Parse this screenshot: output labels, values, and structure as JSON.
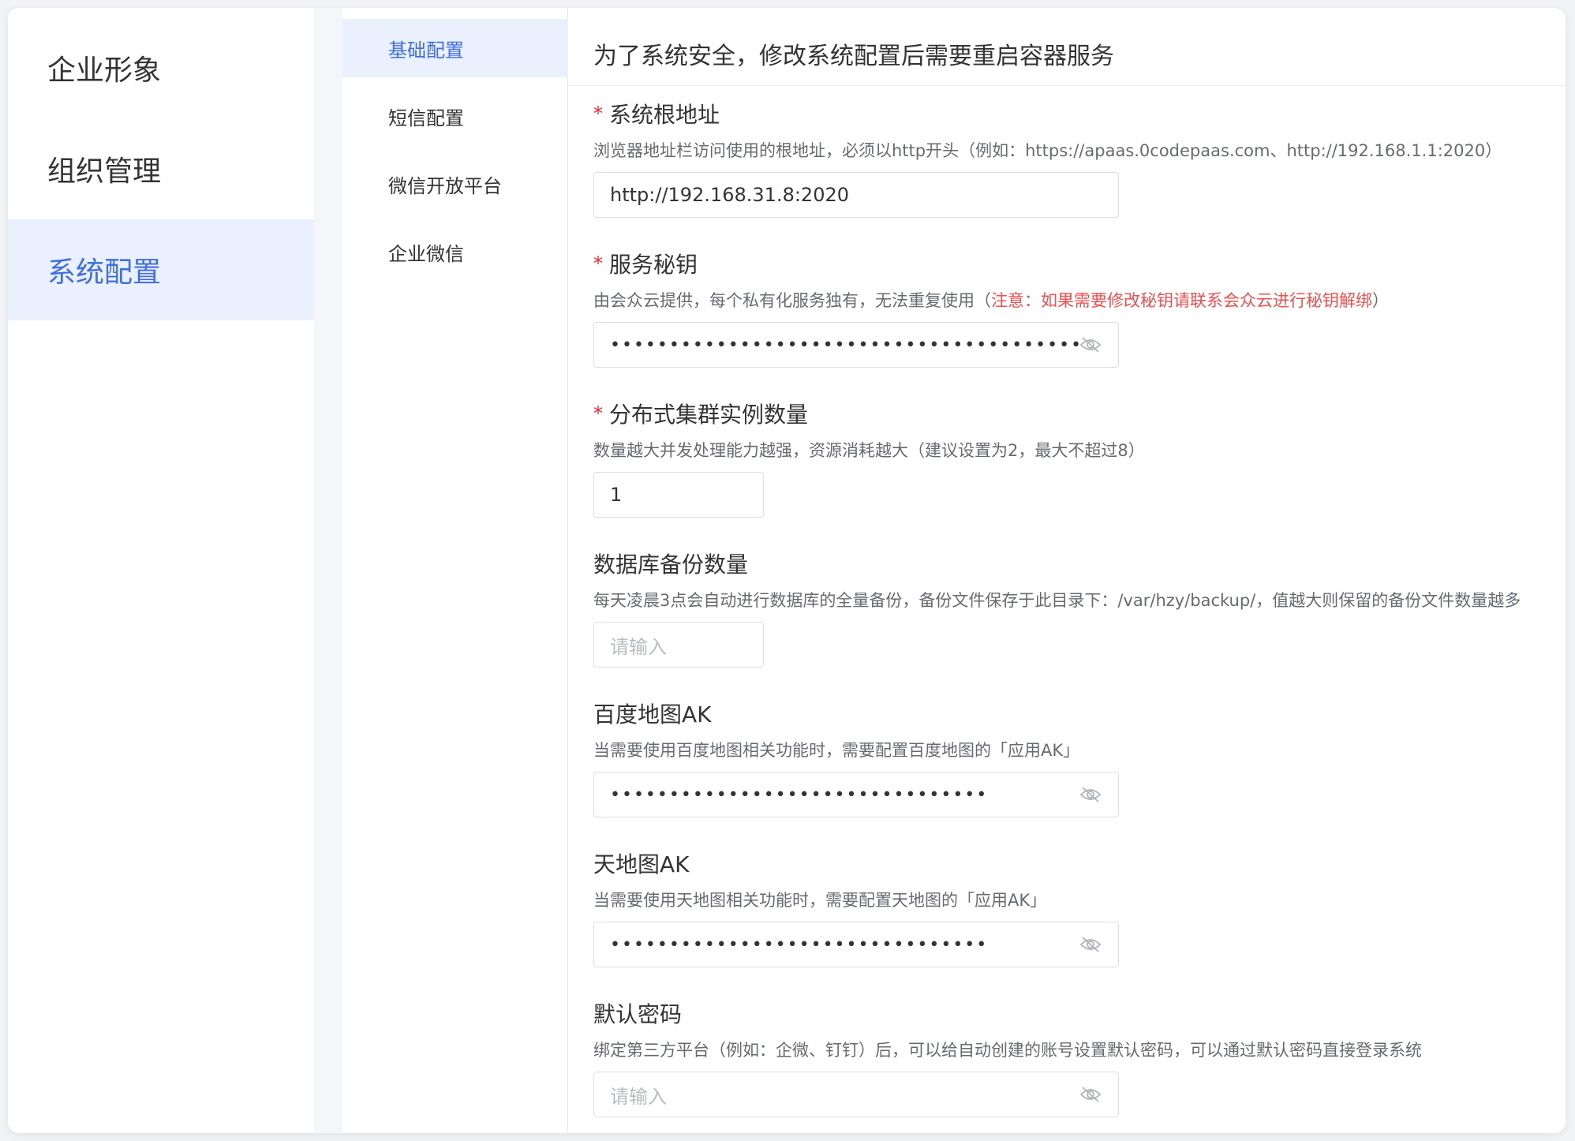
{
  "sidebar": {
    "items": [
      {
        "label": "企业形象",
        "active": false
      },
      {
        "label": "组织管理",
        "active": false
      },
      {
        "label": "系统配置",
        "active": true
      }
    ]
  },
  "subnav": {
    "items": [
      {
        "label": "基础配置",
        "active": true
      },
      {
        "label": "短信配置",
        "active": false
      },
      {
        "label": "微信开放平台",
        "active": false
      },
      {
        "label": "企业微信",
        "active": false
      }
    ]
  },
  "main": {
    "title": "为了系统安全，修改系统配置后需要重启容器服务",
    "fields": {
      "root_url": {
        "required_mark": "*",
        "label": "系统根地址",
        "desc": "浏览器地址栏访问使用的根地址，必须以http开头（例如：https://apaas.0codepaas.com、http://192.168.1.1:2020）",
        "value": "http://192.168.31.8:2020"
      },
      "service_key": {
        "required_mark": "*",
        "label": "服务秘钥",
        "desc_prefix": "由会众云提供，每个私有化服务独有，无法重复使用（",
        "desc_warning": "注意：如果需要修改秘钥请联系会众云进行秘钥解绑",
        "desc_suffix": "）",
        "masked_value": "••••••••••••••••••••••••••••••••••••••••••••••••••",
        "icon": "eye-off-icon"
      },
      "cluster_count": {
        "required_mark": "*",
        "label": "分布式集群实例数量",
        "desc": "数量越大并发处理能力越强，资源消耗越大（建议设置为2，最大不超过8）",
        "value": "1"
      },
      "db_backup": {
        "label": "数据库备份数量",
        "desc": "每天凌晨3点会自动进行数据库的全量备份，备份文件保存于此目录下：/var/hzy/backup/，值越大则保留的备份文件数量越多",
        "placeholder": "请输入"
      },
      "baidu_ak": {
        "label": "百度地图AK",
        "desc": "当需要使用百度地图相关功能时，需要配置百度地图的「应用AK」",
        "masked_value": "••••••••••••••••••••••••••••••••",
        "icon": "eye-off-icon"
      },
      "tianditu_ak": {
        "label": "天地图AK",
        "desc": "当需要使用天地图相关功能时，需要配置天地图的「应用AK」",
        "masked_value": "••••••••••••••••••••••••••••••••",
        "icon": "eye-off-icon"
      },
      "default_password": {
        "label": "默认密码",
        "desc": "绑定第三方平台（例如：企微、钉钉）后，可以给自动创建的账号设置默认密码，可以通过默认密码直接登录系统",
        "placeholder": "请输入",
        "icon": "eye-off-icon"
      }
    }
  },
  "colors": {
    "accent": "#3f6fe0",
    "active_bg": "#eaf0fd",
    "required": "#f5222d",
    "warning": "#f04e4e"
  }
}
